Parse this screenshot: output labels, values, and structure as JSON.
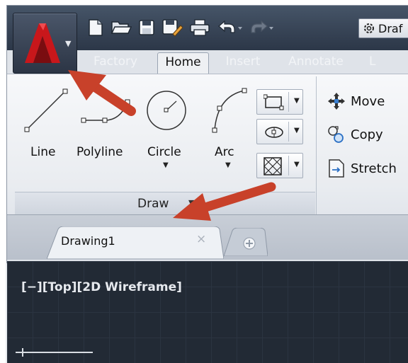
{
  "qat": {
    "items": [
      {
        "icon": "new-file-icon"
      },
      {
        "icon": "open-folder-icon"
      },
      {
        "icon": "save-icon"
      },
      {
        "icon": "save-as-icon"
      },
      {
        "icon": "plot-printer-icon"
      },
      {
        "icon": "undo-icon"
      },
      {
        "icon": "redo-icon"
      }
    ],
    "workspace_label": "Draf"
  },
  "ribbon_tabs": [
    {
      "label": "Factory",
      "active": false
    },
    {
      "label": "Home",
      "active": true
    },
    {
      "label": "Insert",
      "active": false
    },
    {
      "label": "Annotate",
      "active": false
    },
    {
      "label": "L",
      "active": false
    }
  ],
  "draw_panel": {
    "title": "Draw",
    "tools": [
      {
        "label": "Line",
        "icon": "line-icon"
      },
      {
        "label": "Polyline",
        "icon": "polyline-icon"
      },
      {
        "label": "Circle",
        "icon": "circle-icon"
      },
      {
        "label": "Arc",
        "icon": "arc-icon"
      }
    ],
    "small_tools": [
      {
        "icon": "rectangle-icon"
      },
      {
        "icon": "ellipse-icon"
      },
      {
        "icon": "hatch-icon"
      }
    ]
  },
  "modify_panel": {
    "tools": [
      {
        "label": "Move",
        "icon": "move-icon"
      },
      {
        "label": "Copy",
        "icon": "copy-icon"
      },
      {
        "label": "Stretch",
        "icon": "stretch-icon"
      }
    ]
  },
  "file_tabs": {
    "active_tab": "Drawing1",
    "close_glyph": "×"
  },
  "viewport": {
    "label": "[−][Top][2D Wireframe]"
  },
  "colors": {
    "title_bar": "#3a4759",
    "annotation_arrow": "#c8412a",
    "canvas_background": "#222a35"
  }
}
